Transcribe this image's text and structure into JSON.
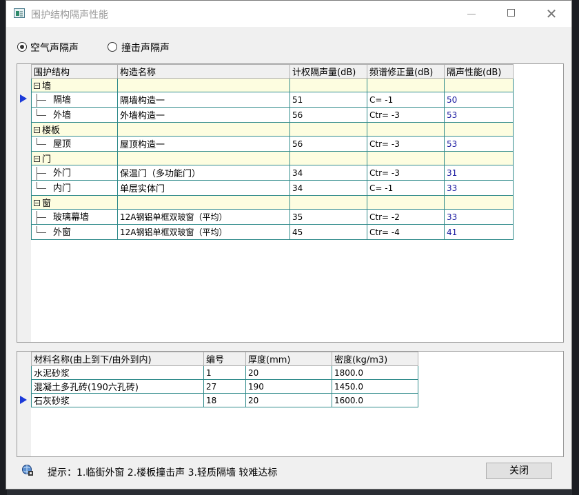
{
  "window": {
    "title": "围护结构隔声性能",
    "close_symbol": "✕"
  },
  "radio": [
    {
      "label": "空气声隔声",
      "selected": true
    },
    {
      "label": "撞击声隔声",
      "selected": false
    }
  ],
  "structure_table": {
    "headers": [
      "围护结构",
      "构造名称",
      "计权隔声量(dB)",
      "频谱修正量(dB)",
      "隔声性能(dB)"
    ],
    "rows": [
      {
        "structure": "墙",
        "name": "",
        "rw": "",
        "correction": "",
        "performance": ""
      },
      {
        "structure": "隔墙",
        "name": "隔墙构造一",
        "rw": "51",
        "correction": "C= -1",
        "performance": "50"
      },
      {
        "structure": "外墙",
        "name": "外墙构造一",
        "rw": "56",
        "correction": "Ctr= -3",
        "performance": "53"
      },
      {
        "structure": "楼板",
        "name": "",
        "rw": "",
        "correction": "",
        "performance": ""
      },
      {
        "structure": "屋顶",
        "name": "屋顶构造一",
        "rw": "56",
        "correction": "Ctr= -3",
        "performance": "53"
      },
      {
        "structure": "门",
        "name": "",
        "rw": "",
        "correction": "",
        "performance": ""
      },
      {
        "structure": "外门",
        "name": "保温门（多功能门）",
        "rw": "34",
        "correction": "Ctr= -3",
        "performance": "31"
      },
      {
        "structure": "内门",
        "name": "单层实体门",
        "rw": "34",
        "correction": "C= -1",
        "performance": "33"
      },
      {
        "structure": "窗",
        "name": "",
        "rw": "",
        "correction": "",
        "performance": ""
      },
      {
        "structure": "玻璃幕墙",
        "name": "12A钢铝单框双玻窗（平均）",
        "rw": "35",
        "correction": "Ctr= -2",
        "performance": "33"
      },
      {
        "structure": "外窗",
        "name": "12A钢铝单框双玻窗（平均）",
        "rw": "45",
        "correction": "Ctr= -4",
        "performance": "41"
      }
    ]
  },
  "material_table": {
    "headers": [
      "材料名称(由上到下/由外到内)",
      "编号",
      "厚度(mm)",
      "密度(kg/m3)"
    ],
    "rows": [
      {
        "name": "水泥砂浆",
        "id": "1",
        "thickness": "20",
        "density": "1800.0"
      },
      {
        "name": "混凝土多孔砖(190六孔砖)",
        "id": "27",
        "thickness": "190",
        "density": "1450.0"
      },
      {
        "name": "石灰砂浆",
        "id": "18",
        "thickness": "20",
        "density": "1600.0"
      }
    ]
  },
  "footer": {
    "hint": "提示：1.临街外窗 2.楼板撞击声 3.轻质隔墙 较难达标",
    "close_label": "关闭"
  },
  "colors": {
    "grid_line": "#2e8a8a",
    "category_row": "#fdfde0",
    "performance_text": "#1a1aa0",
    "row_pointer": "#1c3ad9"
  }
}
